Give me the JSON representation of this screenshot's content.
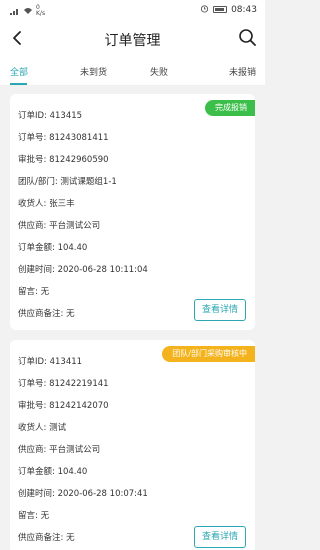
{
  "status_bar": {
    "network_speed_top": "0",
    "network_speed_bottom": "K/s",
    "time": "08:43"
  },
  "header": {
    "title": "订单管理"
  },
  "tabs": [
    {
      "label": "全部"
    },
    {
      "label": "未到货"
    },
    {
      "label": "失败"
    },
    {
      "label": "未报销"
    }
  ],
  "orders": [
    {
      "status": "完成报销",
      "status_color": "#3cbf4a",
      "order_id": "订单ID: 413415",
      "order_no": "订单号: 81243081411",
      "approval_no": "审批号: 81242960590",
      "team": "团队/部门: 测试课题组1-1",
      "receiver": "收货人: 张三丰",
      "supplier": "供应商: 平台测试公司",
      "amount": "订单金额: 104.40",
      "created": "创建时间: 2020-06-28 10:11:04",
      "message": "留言: 无",
      "supplier_note": "供应商备注: 无",
      "detail_label": "查看详情"
    },
    {
      "status": "团队/部门采购审核中",
      "status_color": "#f4b21c",
      "order_id": "订单ID: 413411",
      "order_no": "订单号: 81242219141",
      "approval_no": "审批号: 81242142070",
      "receiver": "收货人: 测试",
      "supplier": "供应商: 平台测试公司",
      "amount": "订单金额: 104.40",
      "created": "创建时间: 2020-06-28 10:07:41",
      "message": "留言: 无",
      "supplier_note": "供应商备注: 无",
      "detail_label": "查看详情"
    }
  ],
  "accent_color": "#2aa7b3"
}
